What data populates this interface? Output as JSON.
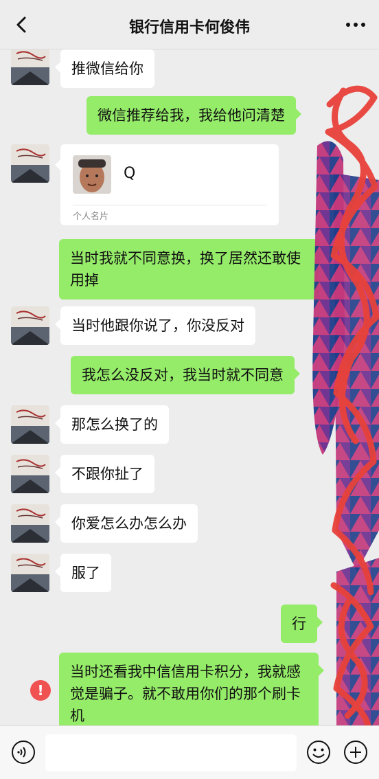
{
  "header": {
    "title": "银行信用卡何俊伟",
    "back_icon": "chevron-left-icon",
    "more_icon": "more-dots-icon"
  },
  "messages": [
    {
      "side": "left",
      "text": "推微信给你"
    },
    {
      "side": "right",
      "text": "微信推荐给我，我给他问清楚"
    },
    {
      "side": "left",
      "type": "contact-card",
      "name": "Q",
      "label": "个人名片"
    },
    {
      "side": "right",
      "text": "当时我就不同意换，换了居然还敢使用掉"
    },
    {
      "side": "left",
      "text": "当时他跟你说了，你没反对"
    },
    {
      "side": "right",
      "text": "我怎么没反对，我当时就不同意"
    },
    {
      "side": "left",
      "text": "那怎么换了的"
    },
    {
      "side": "left",
      "text": "不跟你扯了"
    },
    {
      "side": "left",
      "text": "你爱怎么办怎么办"
    },
    {
      "side": "left",
      "text": "服了"
    },
    {
      "side": "right",
      "text": "行"
    },
    {
      "side": "right",
      "text": "当时还看我中信信用卡积分，我就感觉是骗子。就不敢用你们的那个刷卡机",
      "status": "failed"
    }
  ],
  "input_bar": {
    "placeholder": "",
    "voice_icon": "voice-icon",
    "emoji_icon": "emoji-icon",
    "plus_icon": "plus-icon"
  },
  "colors": {
    "background": "#ededed",
    "sent_bubble": "#95ec69",
    "received_bubble": "#ffffff",
    "error": "#f05151",
    "scribble": "#e8423a"
  }
}
